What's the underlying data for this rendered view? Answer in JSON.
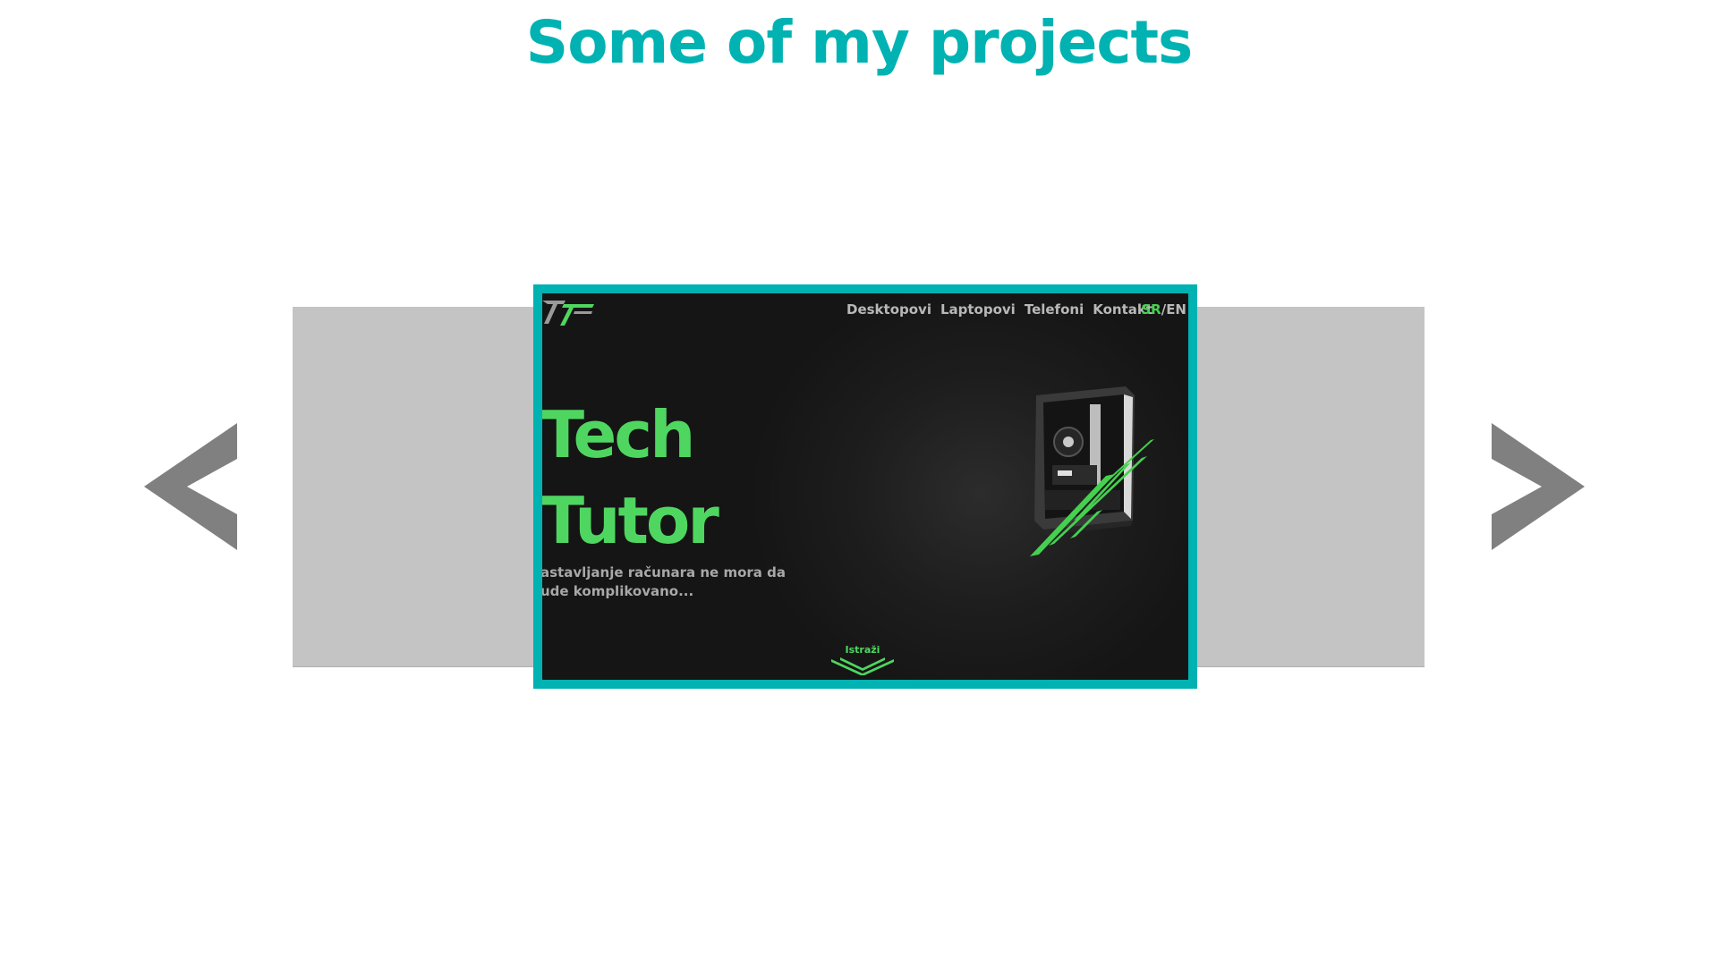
{
  "section": {
    "title": "Some of my projects"
  },
  "colors": {
    "accent": "#00b2b2",
    "side_slide": "#c4c4c4",
    "arrow": "#808080",
    "preview_green": "#4fd660",
    "preview_bg": "#151515"
  },
  "carousel": {
    "prev_icon": "chevron-left-icon",
    "next_icon": "chevron-right-icon",
    "active_project": {
      "nav": [
        "Desktopovi",
        "Laptopovi",
        "Telefoni",
        "Kontakt"
      ],
      "lang_active": "SR",
      "lang_separator": "/",
      "lang_other": "EN",
      "title_line1": "Tech",
      "title_line2": "Tutor",
      "subtitle_line1": "astavljanje računara ne mora da",
      "subtitle_line2": "ude komplikovano...",
      "cta": "Istraži",
      "logo_icon": "tt-logo-icon",
      "image_icon": "pc-case-icon"
    }
  }
}
